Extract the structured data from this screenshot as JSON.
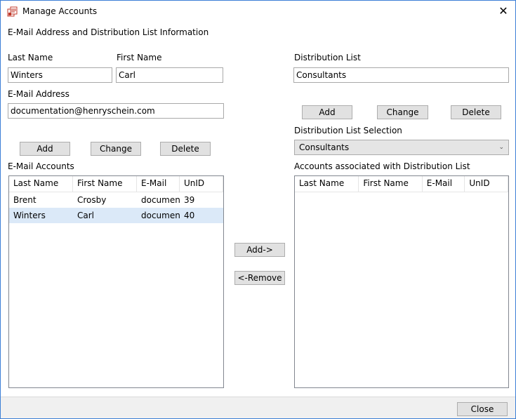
{
  "window": {
    "title": "Manage Accounts",
    "close_glyph": "✕"
  },
  "section_title": "E-Mail Address and Distribution List Information",
  "contact": {
    "last_name_label": "Last Name",
    "last_name_value": "Winters",
    "first_name_label": "First Name",
    "first_name_value": "Carl",
    "email_label": "E-Mail Address",
    "email_value": "documentation@henryschein.com",
    "add": "Add",
    "change": "Change",
    "delete": "Delete"
  },
  "dist": {
    "label": "Distribution List",
    "value": "Consultants",
    "add": "Add",
    "change": "Change",
    "delete": "Delete",
    "selection_label": "Distribution List Selection",
    "selection_value": "Consultants",
    "selection_arrow": "⌄"
  },
  "email_accounts": {
    "label": "E-Mail Accounts",
    "columns": [
      "Last Name",
      "First Name",
      "E-Mail",
      "UnID"
    ],
    "rows": [
      [
        "Brent",
        "Crosby",
        "documen",
        "39"
      ],
      [
        "Winters",
        "Carl",
        "documen",
        "40"
      ]
    ]
  },
  "associated": {
    "label": "Accounts associated with Distribution List",
    "columns": [
      "Last Name",
      "First Name",
      "E-Mail",
      "UnID"
    ]
  },
  "middle": {
    "add": "Add->",
    "remove": "<-Remove"
  },
  "footer": {
    "close": "Close"
  },
  "colors": {
    "window_border": "#3c7fd6",
    "selected_row": "#dbe9f8",
    "button_face": "#e1e1e1"
  }
}
